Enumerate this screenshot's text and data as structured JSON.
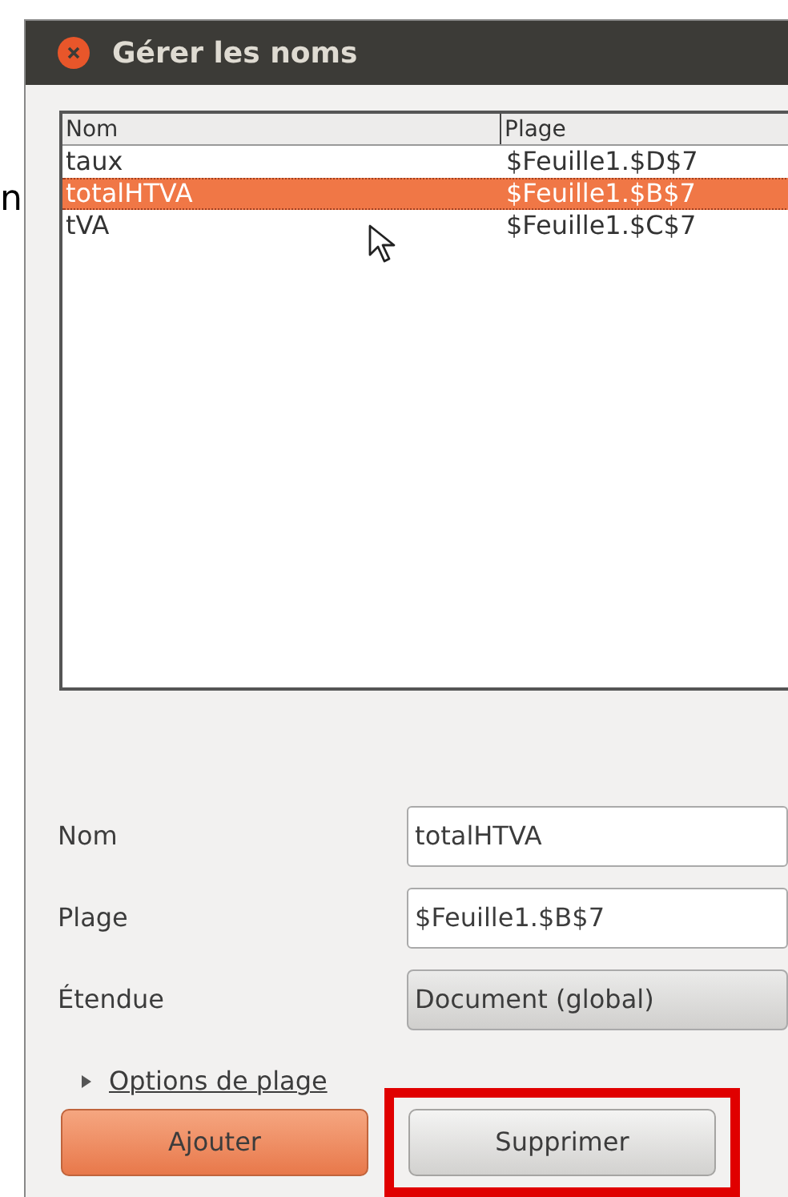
{
  "background_text": "n",
  "window": {
    "title": "Gérer les noms"
  },
  "names_table": {
    "columns": [
      "Nom",
      "Plage"
    ],
    "rows": [
      {
        "cells": [
          "taux",
          "$Feuille1.$D$7"
        ],
        "selected": false
      },
      {
        "cells": [
          "totalHTVA",
          "$Feuille1.$B$7"
        ],
        "selected": true
      },
      {
        "cells": [
          "tVA",
          "$Feuille1.$C$7"
        ],
        "selected": false
      }
    ]
  },
  "form": [
    {
      "kind": "text",
      "label": "Nom",
      "value": "totalHTVA"
    },
    {
      "kind": "text",
      "label": "Plage",
      "value": "$Feuille1.$B$7"
    },
    {
      "kind": "combo",
      "label": "Étendue",
      "value": "Document (global)"
    }
  ],
  "expander": {
    "label": "Options de plage",
    "expanded": false
  },
  "buttons": [
    {
      "label": "Ajouter",
      "kind": "primary",
      "highlighted": false
    },
    {
      "label": "Supprimer",
      "kind": "normal",
      "highlighted": true
    }
  ]
}
